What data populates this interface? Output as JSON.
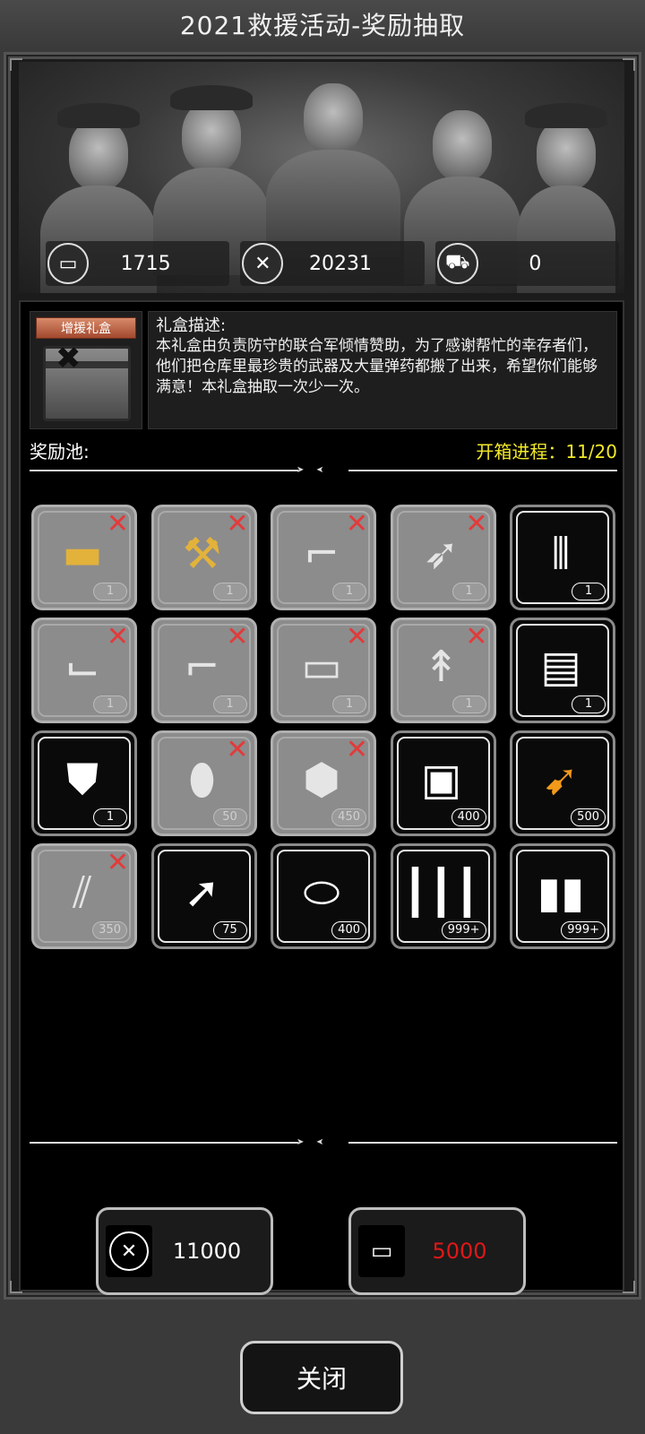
{
  "title": "2021救援活动-奖励抽取",
  "currencies": [
    {
      "icon": "ticket-card-icon",
      "value": "1715"
    },
    {
      "icon": "crossed-swords-icon",
      "value": "20231"
    },
    {
      "icon": "vehicle-icon",
      "value": "0"
    }
  ],
  "gift_box": {
    "tag": "增援礼盒",
    "description_heading": "礼盒描述:",
    "description": "本礼盒由负责防守的联合军倾情赞助，为了感谢帮忙的幸存者们，他们把仓库里最珍贵的武器及大量弹药都搬了出来，希望你们能够满意！本礼盒抽取一次少一次。"
  },
  "pool": {
    "title": "奖励池:",
    "progress": "开箱进程：11/20",
    "items": [
      {
        "name": "golden-shotgun-icon",
        "count": "1",
        "claimed": true
      },
      {
        "name": "golden-hammer-icon",
        "count": "1",
        "claimed": true
      },
      {
        "name": "sniper-rifle-icon",
        "count": "1",
        "claimed": true
      },
      {
        "name": "rocket-launcher-icon",
        "count": "1",
        "claimed": true
      },
      {
        "name": "minigun-icon",
        "count": "1",
        "claimed": false
      },
      {
        "name": "grenade-launcher-icon",
        "count": "1",
        "claimed": true
      },
      {
        "name": "assault-rifle-icon",
        "count": "1",
        "claimed": true
      },
      {
        "name": "pump-shotgun-icon",
        "count": "1",
        "claimed": true
      },
      {
        "name": "spear-icon",
        "count": "1",
        "claimed": true
      },
      {
        "name": "body-armor-icon",
        "count": "1",
        "claimed": false
      },
      {
        "name": "riot-shield-icon",
        "count": "1",
        "claimed": false
      },
      {
        "name": "grenade-icon",
        "count": "50",
        "claimed": true
      },
      {
        "name": "frag-grenade-icon",
        "count": "450",
        "claimed": true
      },
      {
        "name": "incendiary-grenade-icon",
        "count": "400",
        "claimed": false
      },
      {
        "name": "gold-rocket-ammo-icon",
        "count": "500",
        "claimed": false
      },
      {
        "name": "rifle-bullets-icon",
        "count": "350",
        "claimed": true
      },
      {
        "name": "rpg-round-icon",
        "count": "75",
        "claimed": false
      },
      {
        "name": "shotgun-shells-icon",
        "count": "400",
        "claimed": false
      },
      {
        "name": "rifle-ammo-icon",
        "count": "999+",
        "claimed": false
      },
      {
        "name": "pistol-ammo-icon",
        "count": "999+",
        "claimed": false
      }
    ]
  },
  "buttons": {
    "draw_with_medal": "11000",
    "draw_with_card": "5000",
    "close": "关闭"
  }
}
